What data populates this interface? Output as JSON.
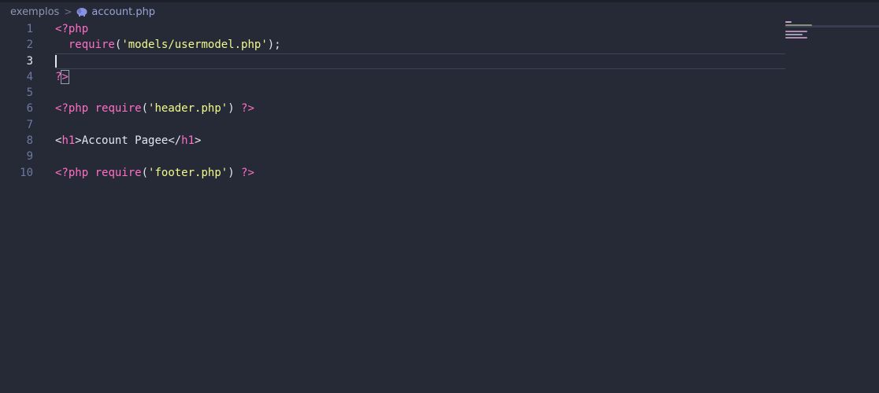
{
  "breadcrumb": {
    "folder": "exemplos",
    "separator": ">",
    "file": "account.php",
    "file_icon": "php-elephant-icon"
  },
  "editor": {
    "active_line": 3,
    "line_numbers": [
      "1",
      "2",
      "3",
      "4",
      "5",
      "6",
      "7",
      "8",
      "9",
      "10"
    ],
    "lines": {
      "l1_tag": "<?php",
      "l2_indent": "  ",
      "l2_fn": "require",
      "l2_open": "(",
      "l2_str": "'models/usermodel.php'",
      "l2_close": ");",
      "l4_tag_q": "?",
      "l4_tag_gt": ">",
      "l6_open": "<?php",
      "l6_fn": " require",
      "l6_paren_open": "(",
      "l6_str": "'header.php'",
      "l6_paren_close": ")",
      "l6_close": " ?>",
      "l8_lt": "<",
      "l8_tag": "h1",
      "l8_gt": ">",
      "l8_text": "Account Pagee",
      "l8_close_lt": "</",
      "l8_close_tag": "h1",
      "l8_close_gt": ">",
      "l10_open": "<?php",
      "l10_fn": " require",
      "l10_paren_open": "(",
      "l10_str": "'footer.php'",
      "l10_paren_close": ")",
      "l10_close": " ?>"
    }
  },
  "colors": {
    "background": "#262a36",
    "keyword": "#ff6ec7",
    "string": "#f1fa8c",
    "text": "#e4e6ef",
    "line_number": "#6d7aa0"
  }
}
